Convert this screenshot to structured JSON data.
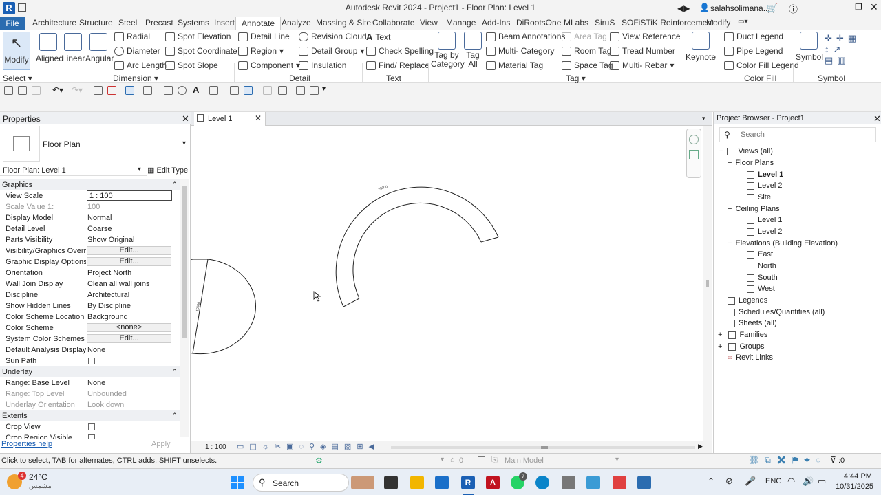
{
  "window": {
    "title": "Autodesk Revit 2024 - Project1 - Floor Plan: Level 1",
    "user": "salahsolimana...",
    "app_logo": "R"
  },
  "ribbon_tabs": [
    "File",
    "Architecture",
    "Structure",
    "Steel",
    "Precast",
    "Systems",
    "Insert",
    "Annotate",
    "Analyze",
    "Massing & Site",
    "Collaborate",
    "View",
    "Manage",
    "Add-Ins",
    "DiRootsOne",
    "MLabs",
    "SiruS",
    "SOFiSTiK Reinforcement",
    "Modify"
  ],
  "ribbon": {
    "modify": "Modify",
    "select": "Select",
    "dimension": {
      "aligned": "Aligned",
      "linear": "Linear",
      "angular": "Angular",
      "radial": "Radial",
      "diameter": "Diameter",
      "arc_length": "Arc Length",
      "spot_elevation": "Spot Elevation",
      "spot_coordinate": "Spot Coordinate",
      "spot_slope": "Spot Slope",
      "label": "Dimension"
    },
    "detail": {
      "detail_line": "Detail Line",
      "region": "Region",
      "component": "Component",
      "revision_cloud": "Revision Cloud",
      "detail_group": "Detail Group",
      "insulation": "Insulation",
      "label": "Detail"
    },
    "text": {
      "text": "Text",
      "check_spelling": "Check Spelling",
      "find_replace": "Find/ Replace",
      "label": "Text"
    },
    "tag": {
      "tag_by_category": "Tag by Category",
      "tag_all": "Tag All",
      "beam_annotations": "Beam Annotations",
      "multi_category": "Multi- Category",
      "material_tag": "Material Tag",
      "area_tag": "Area Tag",
      "room_tag": "Room Tag",
      "space_tag": "Space Tag",
      "view_reference": "View Reference",
      "tread_number": "Tread Number",
      "multi_rebar": "Multi- Rebar",
      "keynote": "Keynote",
      "label": "Tag"
    },
    "color_fill": {
      "duct_legend": "Duct Legend",
      "pipe_legend": "Pipe Legend",
      "color_fill_legend": "Color Fill Legend",
      "label": "Color Fill"
    },
    "symbol": {
      "symbol": "Symbol",
      "label": "Symbol"
    }
  },
  "properties": {
    "title": "Properties",
    "type_name": "Floor Plan",
    "instance": "Floor Plan: Level 1",
    "edit_type": "Edit Type",
    "sections": {
      "graphics": "Graphics",
      "underlay": "Underlay",
      "extents": "Extents"
    },
    "rows": [
      {
        "k": "View Scale",
        "v": "1 : 100"
      },
      {
        "k": "Scale Value    1:",
        "v": "100"
      },
      {
        "k": "Display Model",
        "v": "Normal"
      },
      {
        "k": "Detail Level",
        "v": "Coarse"
      },
      {
        "k": "Parts Visibility",
        "v": "Show Original"
      },
      {
        "k": "Visibility/Graphics Overri...",
        "v": "Edit..."
      },
      {
        "k": "Graphic Display Options",
        "v": "Edit..."
      },
      {
        "k": "Orientation",
        "v": "Project North"
      },
      {
        "k": "Wall Join Display",
        "v": "Clean all wall joins"
      },
      {
        "k": "Discipline",
        "v": "Architectural"
      },
      {
        "k": "Show Hidden Lines",
        "v": "By Discipline"
      },
      {
        "k": "Color Scheme Location",
        "v": "Background"
      },
      {
        "k": "Color Scheme",
        "v": "<none>"
      },
      {
        "k": "System Color Schemes",
        "v": "Edit..."
      },
      {
        "k": "Default Analysis Display ...",
        "v": "None"
      },
      {
        "k": "Sun Path",
        "v": ""
      },
      {
        "k": "Range: Base Level",
        "v": "None"
      },
      {
        "k": "Range: Top Level",
        "v": "Unbounded"
      },
      {
        "k": "Underlay Orientation",
        "v": "Look down"
      },
      {
        "k": "Crop View",
        "v": ""
      },
      {
        "k": "Crop Region Visible",
        "v": ""
      }
    ],
    "help": "Properties help",
    "apply": "Apply"
  },
  "view": {
    "tab": "Level 1",
    "scale": "1 : 100"
  },
  "browser": {
    "title": "Project Browser - Project1",
    "search_placeholder": "Search",
    "items": [
      "Views (all)",
      "Floor Plans",
      "Level 1",
      "Level 2",
      "Site",
      "Ceiling Plans",
      "Level 1",
      "Level 2",
      "Elevations (Building Elevation)",
      "East",
      "North",
      "South",
      "West",
      "Legends",
      "Schedules/Quantities (all)",
      "Sheets (all)",
      "Families",
      "Groups",
      "Revit Links"
    ]
  },
  "status": {
    "hint": "Click to select, TAB for alternates, CTRL adds, SHIFT unselects.",
    "count": ":0",
    "model": "Main Model",
    "filter": ":0"
  },
  "taskbar": {
    "temp": "24°C",
    "weather": "مشمس",
    "badge": "4",
    "search": "Search",
    "lang": "ENG",
    "time": "4:44 PM",
    "date": "10/31/2025",
    "whatsapp_badge": "7"
  }
}
